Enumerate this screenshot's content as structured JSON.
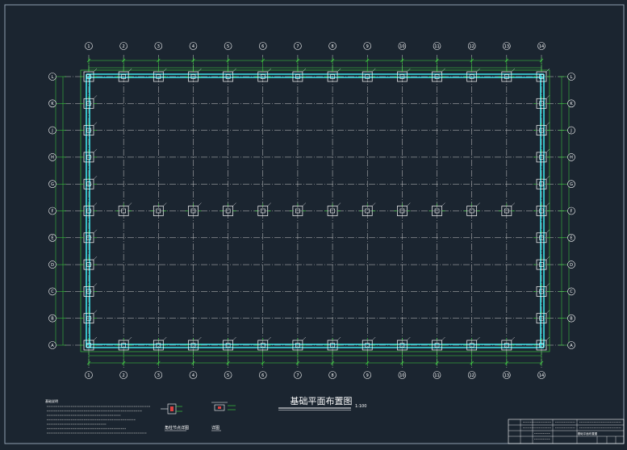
{
  "drawing": {
    "title": "基础平面布置图",
    "scale": "1:100",
    "notes_heading": "基础说明",
    "detail_1_label": "角柱节点详图",
    "detail_2_label": "详图"
  },
  "grid": {
    "columns": [
      "1",
      "2",
      "3",
      "4",
      "5",
      "6",
      "7",
      "8",
      "9",
      "10",
      "11",
      "12",
      "13",
      "14"
    ],
    "rows": [
      "A",
      "B",
      "C",
      "D",
      "E",
      "F",
      "G",
      "H",
      "J",
      "K",
      "L"
    ]
  },
  "title_block": {
    "block_label": "基础平面布置图"
  },
  "colors": {
    "background": "#1b2530",
    "grid_line": "#c9c9c9",
    "dimension": "#3fdc3f",
    "beam": "#3ee3ea",
    "footing": "#ffffff",
    "text": "#ffffff"
  }
}
